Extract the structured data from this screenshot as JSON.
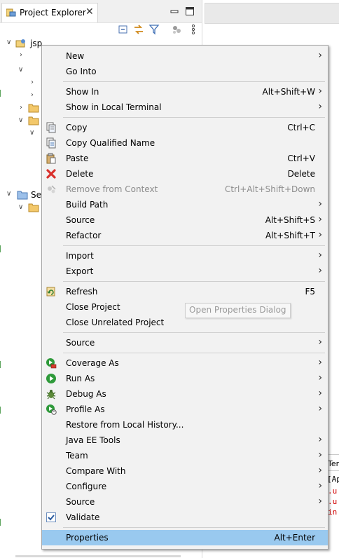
{
  "view": {
    "title": "Project Explorer",
    "project_name": "jsp",
    "partial_item": "Ser"
  },
  "console": {
    "line1": "Ter",
    "line2": "[Ap",
    "line3": ".u",
    "line4": ".u",
    "line5": "in"
  },
  "menu": {
    "new": "New",
    "go_into": "Go Into",
    "show_in": "Show In",
    "show_in_acc": "Alt+Shift+W",
    "show_in_terminal": "Show in Local Terminal",
    "copy": "Copy",
    "copy_acc": "Ctrl+C",
    "copy_qualified": "Copy Qualified Name",
    "paste": "Paste",
    "paste_acc": "Ctrl+V",
    "delete": "Delete",
    "delete_acc": "Delete",
    "remove_context": "Remove from Context",
    "remove_context_acc": "Ctrl+Alt+Shift+Down",
    "build_path": "Build Path",
    "source_1": "Source",
    "source_1_acc": "Alt+Shift+S",
    "refactor": "Refactor",
    "refactor_acc": "Alt+Shift+T",
    "import": "Import",
    "export": "Export",
    "refresh": "Refresh",
    "refresh_acc": "F5",
    "close_project": "Close Project",
    "close_unrelated": "Close Unrelated Project",
    "source_2": "Source",
    "coverage_as": "Coverage As",
    "run_as": "Run As",
    "debug_as": "Debug As",
    "profile_as": "Profile As",
    "restore_history": "Restore from Local History...",
    "java_ee_tools": "Java EE Tools",
    "team": "Team",
    "compare_with": "Compare With",
    "configure": "Configure",
    "source_3": "Source",
    "validate": "Validate",
    "properties": "Properties",
    "properties_acc": "Alt+Enter"
  },
  "tooltip": "Open Properties Dialog"
}
